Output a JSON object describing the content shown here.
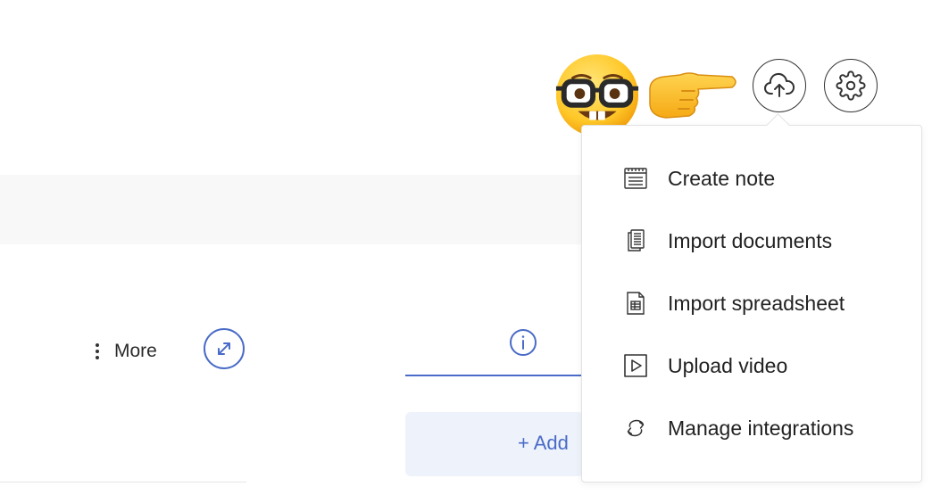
{
  "toolbar": {
    "more_label": "More"
  },
  "add_button": {
    "label": "+ Add"
  },
  "header_icons": {
    "upload": "cloud-upload-icon",
    "settings": "gear-icon"
  },
  "emojis": {
    "nerd": "nerd-face-emoji",
    "pointer": "backhand-index-pointing-right-emoji"
  },
  "upload_menu": {
    "items": [
      {
        "label": "Create note",
        "icon": "note-icon"
      },
      {
        "label": "Import documents",
        "icon": "documents-icon"
      },
      {
        "label": "Import spreadsheet",
        "icon": "spreadsheet-icon"
      },
      {
        "label": "Upload video",
        "icon": "video-icon"
      },
      {
        "label": "Manage integrations",
        "icon": "integrations-icon"
      }
    ]
  },
  "colors": {
    "accent": "#4a6bc7",
    "add_bg": "#eef3fb",
    "band": "#f8f8f8"
  }
}
